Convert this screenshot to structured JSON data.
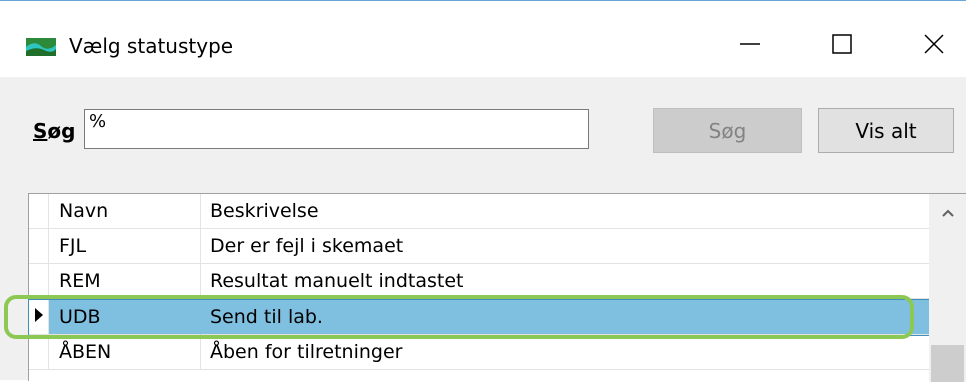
{
  "window": {
    "title": "Vælg statustype",
    "icon": "landscape-app-icon",
    "controls": {
      "minimize": "minimize-icon",
      "maximize": "maximize-icon",
      "close": "close-icon"
    }
  },
  "search": {
    "label_underlined": "S",
    "label_rest": "øg",
    "value": "%",
    "search_button": "Søg",
    "show_all_button": "Vis alt"
  },
  "grid": {
    "columns": [
      "Navn",
      "Beskrivelse"
    ],
    "rows": [
      {
        "name": "FJL",
        "description": "Der er fejl i skemaet",
        "selected": false
      },
      {
        "name": "REM",
        "description": "Resultat manuelt indtastet",
        "selected": false
      },
      {
        "name": "UDB",
        "description": "Send til lab.",
        "selected": true
      },
      {
        "name": "ÅBEN",
        "description": "Åben for tilretninger",
        "selected": false
      }
    ]
  },
  "colors": {
    "selection": "#7fc0e0",
    "highlight_outline": "#8dc854",
    "disabled_button": "#cccccc"
  }
}
